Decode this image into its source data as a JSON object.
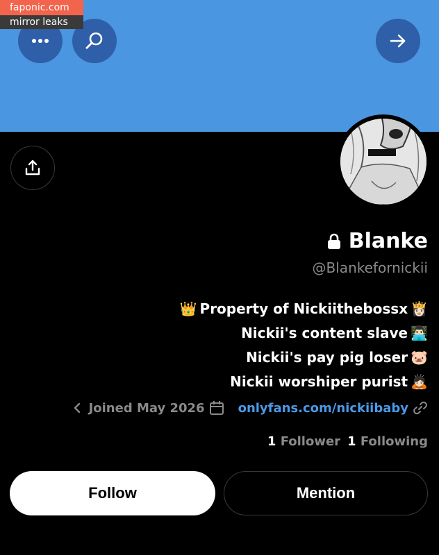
{
  "watermark": {
    "site": "faponic.com",
    "tagline": "mirror leaks"
  },
  "icons": {
    "more": "more-horizontal-icon",
    "search": "search-icon",
    "forward": "arrow-right-icon",
    "share": "share-upload-icon",
    "lock": "lock-icon",
    "link": "link-icon",
    "calendar": "calendar-icon",
    "chevron": "chevron-icon"
  },
  "profile": {
    "display_name": "Blanke",
    "handle": "@Blankefornickii",
    "bio": [
      {
        "emoji": "👸🏻",
        "text": "Property of Nickiithebossx",
        "suffix_emoji": "👑"
      },
      {
        "emoji": "👨🏻‍💻",
        "text": "Nickii's content slave"
      },
      {
        "emoji": "🐷",
        "text": "Nickii's pay pig loser"
      },
      {
        "emoji": "🙇🏻",
        "text": "Nickii worshiper purist"
      }
    ],
    "link": "onlyfans.com/nickiibaby",
    "joined": "Joined May 2026",
    "following_count": "1",
    "following_label": "Following",
    "followers_count": "1",
    "followers_label": "Follower"
  },
  "actions": {
    "follow": "Follow",
    "mention": "Mention"
  },
  "colors": {
    "banner": "#4a96e0",
    "link": "#4a9be8",
    "button_blue": "#2f5fa8"
  }
}
